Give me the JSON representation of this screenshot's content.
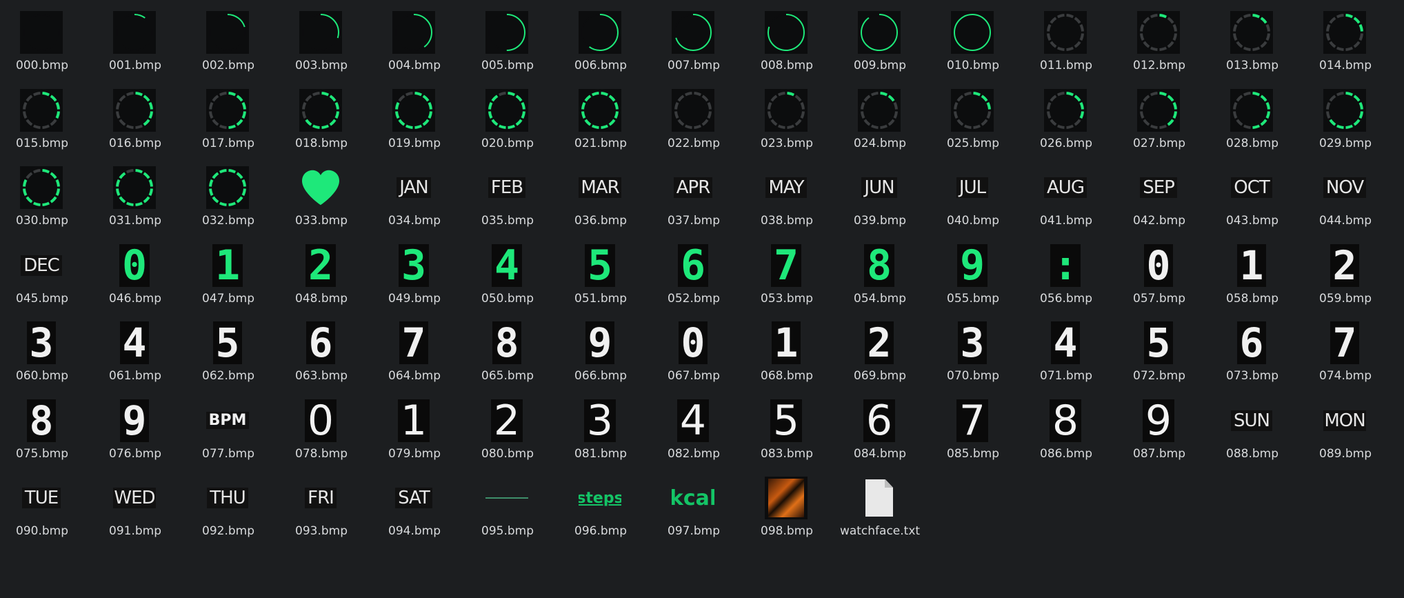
{
  "files": [
    {
      "name": "000.bmp",
      "kind": "ring",
      "ring": 0.0
    },
    {
      "name": "001.bmp",
      "kind": "ring",
      "ring": 0.1
    },
    {
      "name": "002.bmp",
      "kind": "ring",
      "ring": 0.2
    },
    {
      "name": "003.bmp",
      "kind": "ring",
      "ring": 0.3
    },
    {
      "name": "004.bmp",
      "kind": "ring",
      "ring": 0.4
    },
    {
      "name": "005.bmp",
      "kind": "ring",
      "ring": 0.5
    },
    {
      "name": "006.bmp",
      "kind": "ring",
      "ring": 0.6
    },
    {
      "name": "007.bmp",
      "kind": "ring",
      "ring": 0.7
    },
    {
      "name": "008.bmp",
      "kind": "ring",
      "ring": 0.8
    },
    {
      "name": "009.bmp",
      "kind": "ring",
      "ring": 0.9
    },
    {
      "name": "010.bmp",
      "kind": "ring",
      "ring": 1.0
    },
    {
      "name": "011.bmp",
      "kind": "seg",
      "seg": 0
    },
    {
      "name": "012.bmp",
      "kind": "seg",
      "seg": 1
    },
    {
      "name": "013.bmp",
      "kind": "seg",
      "seg": 2
    },
    {
      "name": "014.bmp",
      "kind": "seg",
      "seg": 3
    },
    {
      "name": "015.bmp",
      "kind": "seg",
      "seg": 4
    },
    {
      "name": "016.bmp",
      "kind": "seg",
      "seg": 5
    },
    {
      "name": "017.bmp",
      "kind": "seg",
      "seg": 6
    },
    {
      "name": "018.bmp",
      "kind": "seg",
      "seg": 8
    },
    {
      "name": "019.bmp",
      "kind": "seg",
      "seg": 10
    },
    {
      "name": "020.bmp",
      "kind": "seg",
      "seg": 11
    },
    {
      "name": "021.bmp",
      "kind": "seg",
      "seg": 12
    },
    {
      "name": "022.bmp",
      "kind": "seg",
      "seg": 0
    },
    {
      "name": "023.bmp",
      "kind": "seg",
      "seg": 1
    },
    {
      "name": "024.bmp",
      "kind": "seg",
      "seg": 2
    },
    {
      "name": "025.bmp",
      "kind": "seg",
      "seg": 3
    },
    {
      "name": "026.bmp",
      "kind": "seg",
      "seg": 4
    },
    {
      "name": "027.bmp",
      "kind": "seg",
      "seg": 5
    },
    {
      "name": "028.bmp",
      "kind": "seg",
      "seg": 6
    },
    {
      "name": "029.bmp",
      "kind": "seg",
      "seg": 8
    },
    {
      "name": "030.bmp",
      "kind": "seg",
      "seg": 10
    },
    {
      "name": "031.bmp",
      "kind": "seg",
      "seg": 11
    },
    {
      "name": "032.bmp",
      "kind": "seg",
      "seg": 12
    },
    {
      "name": "033.bmp",
      "kind": "heart"
    },
    {
      "name": "034.bmp",
      "kind": "text",
      "text": "JAN"
    },
    {
      "name": "035.bmp",
      "kind": "text",
      "text": "FEB"
    },
    {
      "name": "036.bmp",
      "kind": "text",
      "text": "MAR"
    },
    {
      "name": "037.bmp",
      "kind": "text",
      "text": "APR"
    },
    {
      "name": "038.bmp",
      "kind": "text",
      "text": "MAY"
    },
    {
      "name": "039.bmp",
      "kind": "text",
      "text": "JUN"
    },
    {
      "name": "040.bmp",
      "kind": "text",
      "text": "JUL"
    },
    {
      "name": "041.bmp",
      "kind": "text",
      "text": "AUG"
    },
    {
      "name": "042.bmp",
      "kind": "text",
      "text": "SEP"
    },
    {
      "name": "043.bmp",
      "kind": "text",
      "text": "OCT"
    },
    {
      "name": "044.bmp",
      "kind": "text",
      "text": "NOV"
    },
    {
      "name": "045.bmp",
      "kind": "text",
      "text": "DEC"
    },
    {
      "name": "046.bmp",
      "kind": "green",
      "text": "0"
    },
    {
      "name": "047.bmp",
      "kind": "green",
      "text": "1"
    },
    {
      "name": "048.bmp",
      "kind": "green",
      "text": "2"
    },
    {
      "name": "049.bmp",
      "kind": "green",
      "text": "3"
    },
    {
      "name": "050.bmp",
      "kind": "green",
      "text": "4"
    },
    {
      "name": "051.bmp",
      "kind": "green",
      "text": "5"
    },
    {
      "name": "052.bmp",
      "kind": "green",
      "text": "6"
    },
    {
      "name": "053.bmp",
      "kind": "green",
      "text": "7"
    },
    {
      "name": "054.bmp",
      "kind": "green",
      "text": "8"
    },
    {
      "name": "055.bmp",
      "kind": "green",
      "text": "9"
    },
    {
      "name": "056.bmp",
      "kind": "green",
      "text": ":"
    },
    {
      "name": "057.bmp",
      "kind": "white",
      "text": "0"
    },
    {
      "name": "058.bmp",
      "kind": "white",
      "text": "1"
    },
    {
      "name": "059.bmp",
      "kind": "white",
      "text": "2"
    },
    {
      "name": "060.bmp",
      "kind": "white",
      "text": "3"
    },
    {
      "name": "061.bmp",
      "kind": "white",
      "text": "4"
    },
    {
      "name": "062.bmp",
      "kind": "white",
      "text": "5"
    },
    {
      "name": "063.bmp",
      "kind": "white",
      "text": "6"
    },
    {
      "name": "064.bmp",
      "kind": "white",
      "text": "7"
    },
    {
      "name": "065.bmp",
      "kind": "white",
      "text": "8"
    },
    {
      "name": "066.bmp",
      "kind": "white",
      "text": "9"
    },
    {
      "name": "067.bmp",
      "kind": "white",
      "text": "0"
    },
    {
      "name": "068.bmp",
      "kind": "white",
      "text": "1"
    },
    {
      "name": "069.bmp",
      "kind": "white",
      "text": "2"
    },
    {
      "name": "070.bmp",
      "kind": "white",
      "text": "3"
    },
    {
      "name": "071.bmp",
      "kind": "white",
      "text": "4"
    },
    {
      "name": "072.bmp",
      "kind": "white",
      "text": "5"
    },
    {
      "name": "073.bmp",
      "kind": "white",
      "text": "6"
    },
    {
      "name": "074.bmp",
      "kind": "white",
      "text": "7"
    },
    {
      "name": "075.bmp",
      "kind": "white",
      "text": "8"
    },
    {
      "name": "076.bmp",
      "kind": "white",
      "text": "9"
    },
    {
      "name": "077.bmp",
      "kind": "bpm",
      "text": "BPM"
    },
    {
      "name": "078.bmp",
      "kind": "thin",
      "text": "0"
    },
    {
      "name": "079.bmp",
      "kind": "thin",
      "text": "1"
    },
    {
      "name": "080.bmp",
      "kind": "thin",
      "text": "2"
    },
    {
      "name": "081.bmp",
      "kind": "thin",
      "text": "3"
    },
    {
      "name": "082.bmp",
      "kind": "thin",
      "text": "4"
    },
    {
      "name": "083.bmp",
      "kind": "thin",
      "text": "5"
    },
    {
      "name": "084.bmp",
      "kind": "thin",
      "text": "6"
    },
    {
      "name": "085.bmp",
      "kind": "thin",
      "text": "7"
    },
    {
      "name": "086.bmp",
      "kind": "thin",
      "text": "8"
    },
    {
      "name": "087.bmp",
      "kind": "thin",
      "text": "9"
    },
    {
      "name": "088.bmp",
      "kind": "text",
      "text": "SUN"
    },
    {
      "name": "089.bmp",
      "kind": "text",
      "text": "MON"
    },
    {
      "name": "090.bmp",
      "kind": "text",
      "text": "TUE"
    },
    {
      "name": "091.bmp",
      "kind": "text",
      "text": "WED"
    },
    {
      "name": "092.bmp",
      "kind": "text",
      "text": "THU"
    },
    {
      "name": "093.bmp",
      "kind": "text",
      "text": "FRI"
    },
    {
      "name": "094.bmp",
      "kind": "text",
      "text": "SAT"
    },
    {
      "name": "095.bmp",
      "kind": "line"
    },
    {
      "name": "096.bmp",
      "kind": "steps",
      "text": "steps"
    },
    {
      "name": "097.bmp",
      "kind": "kcal",
      "text": "kcal"
    },
    {
      "name": "098.bmp",
      "kind": "photo"
    },
    {
      "name": "watchface.txt",
      "kind": "doc"
    }
  ],
  "colors": {
    "background": "#1c1e20",
    "accent_green": "#1ee87a",
    "ring_track": "#3a3c3e",
    "label": "#d8dadc"
  }
}
